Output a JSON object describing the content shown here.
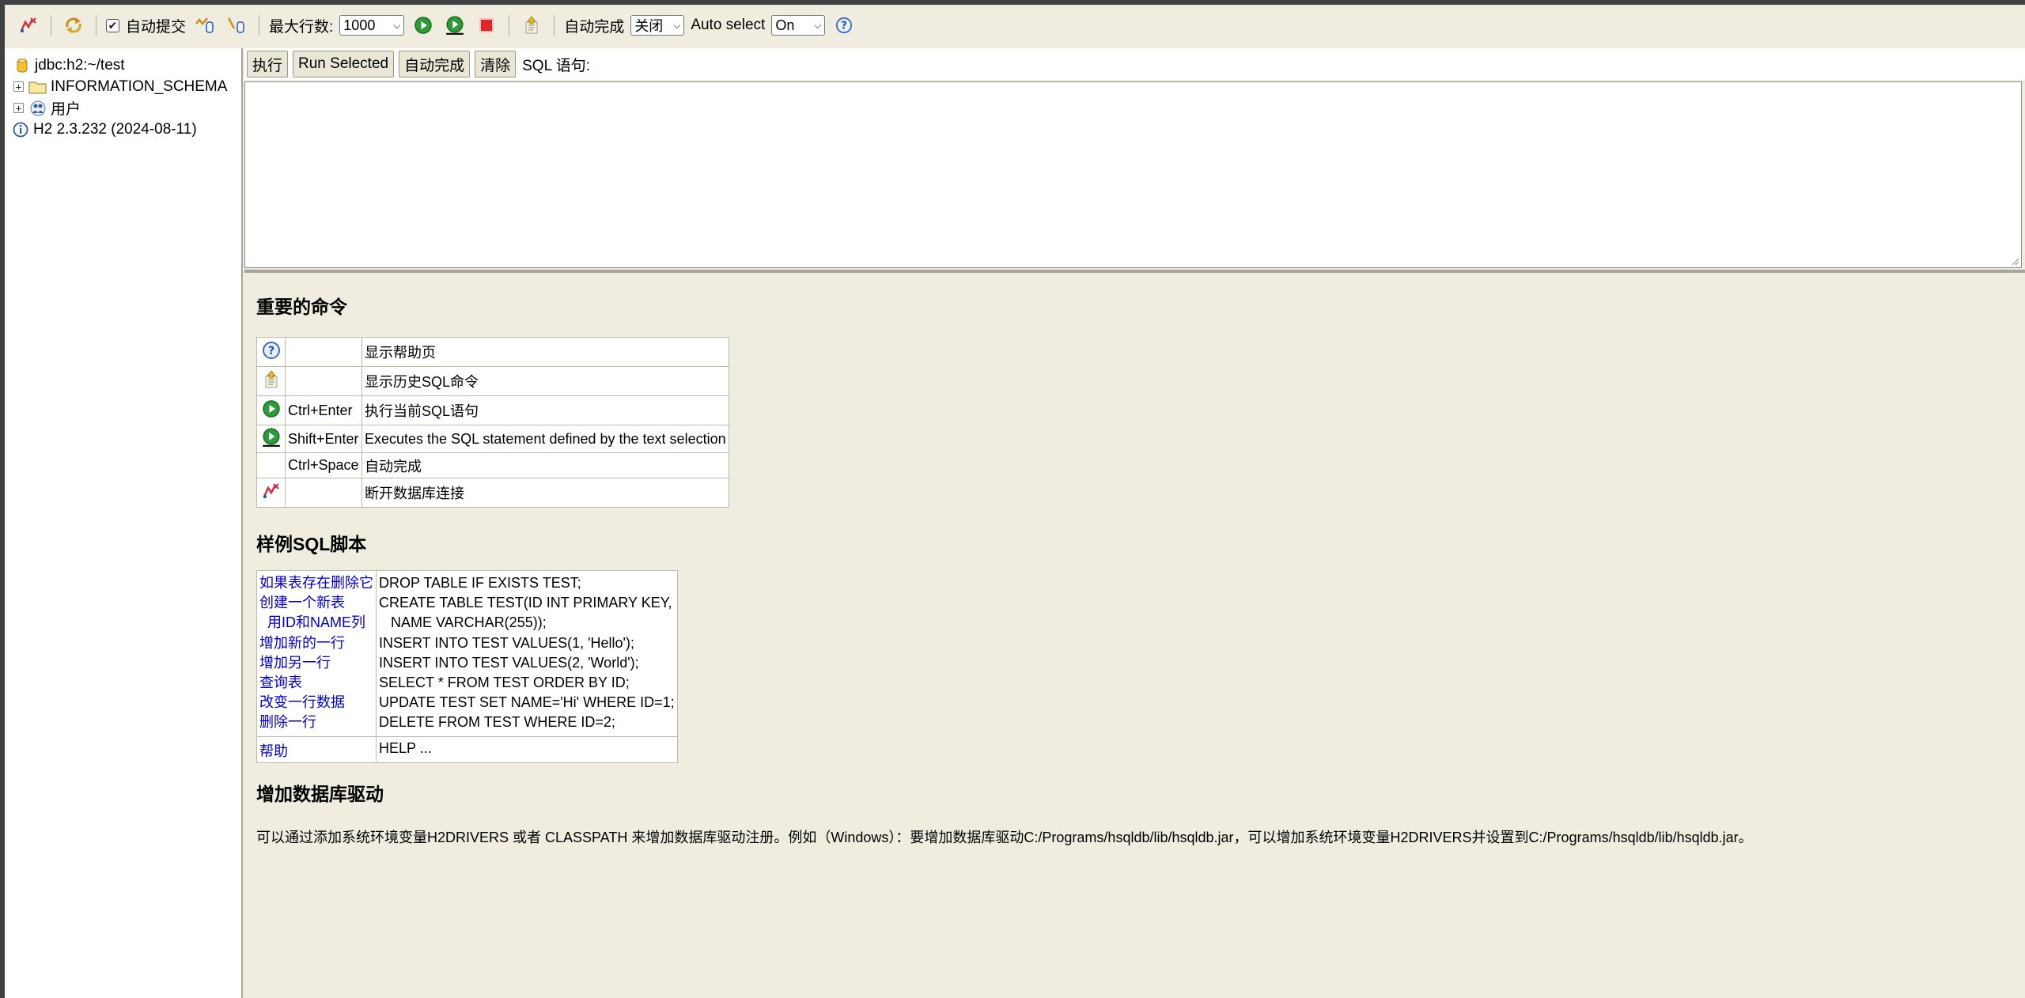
{
  "toolbar": {
    "autocommit_label": "自动提交",
    "max_rows_label": "最大行数:",
    "max_rows_value": "1000",
    "autocomplete_label": "自动完成",
    "autocomplete_value": "关闭",
    "auto_select_label": "Auto select",
    "auto_select_value": "On",
    "icons": [
      "disconnect-icon",
      "refresh-icon",
      "commit-icon",
      "rollback-icon",
      "run-icon",
      "run-selected-icon",
      "stop-icon",
      "history-icon",
      "help-icon"
    ]
  },
  "tree": {
    "connection": "jdbc:h2:~/test",
    "items": [
      {
        "label": "INFORMATION_SCHEMA",
        "icon": "folder-icon"
      },
      {
        "label": "用户",
        "icon": "users-icon"
      }
    ],
    "version": "H2 2.3.232 (2024-08-11)"
  },
  "sqlbar": {
    "execute": "执行",
    "run_selected": "Run Selected",
    "autocomplete": "自动完成",
    "clear": "清除",
    "label": "SQL 语句:"
  },
  "help": {
    "important_title": "重要的命令",
    "commands": [
      {
        "icon": "help-icon",
        "key": "",
        "desc": "显示帮助页"
      },
      {
        "icon": "history-icon",
        "key": "",
        "desc": "显示历史SQL命令"
      },
      {
        "icon": "run-icon",
        "key": "Ctrl+Enter",
        "desc": "执行当前SQL语句"
      },
      {
        "icon": "run-selected-icon",
        "key": "Shift+Enter",
        "desc": "Executes the SQL statement defined by the text selection"
      },
      {
        "icon": "",
        "key": "Ctrl+Space",
        "desc": "自动完成"
      },
      {
        "icon": "disconnect-icon",
        "key": "",
        "desc": "断开数据库连接"
      }
    ],
    "sample_title": "样例SQL脚本",
    "sample_links": [
      "如果表存在删除它",
      "创建一个新表",
      "  用ID和NAME列",
      "增加新的一行",
      "增加另一行",
      "查询表",
      "改变一行数据",
      "删除一行"
    ],
    "sample_sql": [
      "DROP TABLE IF EXISTS TEST;",
      "CREATE TABLE TEST(ID INT PRIMARY KEY,",
      "   NAME VARCHAR(255));",
      "INSERT INTO TEST VALUES(1, 'Hello');",
      "INSERT INTO TEST VALUES(2, 'World');",
      "SELECT * FROM TEST ORDER BY ID;",
      "UPDATE TEST SET NAME='Hi' WHERE ID=1;",
      "DELETE FROM TEST WHERE ID=2;"
    ],
    "help_link": "帮助",
    "help_sql": "HELP ...",
    "driver_title": "增加数据库驱动",
    "driver_text": "可以通过添加系统环境变量H2DRIVERS 或者 CLASSPATH 来增加数据库驱动注册。例如（Windows）：要增加数据库驱动C:/Programs/hsqldb/lib/hsqldb.jar，可以增加系统环境变量H2DRIVERS并设置到C:/Programs/hsqldb/lib/hsqldb.jar。"
  }
}
